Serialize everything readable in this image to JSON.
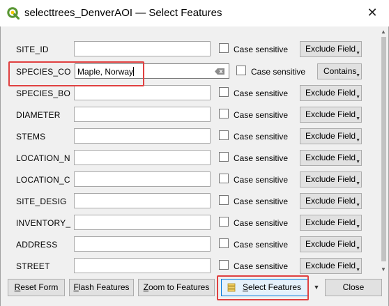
{
  "window": {
    "title": "selecttrees_DenverAOI — Select Features",
    "close_glyph": "✕"
  },
  "fields": [
    {
      "label": "SITE_ID",
      "value": "",
      "case_label": "Case sensitive",
      "mode": "Exclude Field"
    },
    {
      "label": "SPECIES_CO",
      "value": "Maple, Norway",
      "case_label": "Case sensitive",
      "mode": "Contains"
    },
    {
      "label": "SPECIES_BO",
      "value": "",
      "case_label": "Case sensitive",
      "mode": "Exclude Field"
    },
    {
      "label": "DIAMETER",
      "value": "",
      "case_label": "Case sensitive",
      "mode": "Exclude Field"
    },
    {
      "label": "STEMS",
      "value": "",
      "case_label": "Case sensitive",
      "mode": "Exclude Field"
    },
    {
      "label": "LOCATION_N",
      "value": "",
      "case_label": "Case sensitive",
      "mode": "Exclude Field"
    },
    {
      "label": "LOCATION_C",
      "value": "",
      "case_label": "Case sensitive",
      "mode": "Exclude Field"
    },
    {
      "label": "SITE_DESIG",
      "value": "",
      "case_label": "Case sensitive",
      "mode": "Exclude Field"
    },
    {
      "label": "INVENTORY_",
      "value": "",
      "case_label": "Case sensitive",
      "mode": "Exclude Field"
    },
    {
      "label": "ADDRESS",
      "value": "",
      "case_label": "Case sensitive",
      "mode": "Exclude Field"
    },
    {
      "label": "STREET",
      "value": "",
      "case_label": "Case sensitive",
      "mode": "Exclude Field"
    }
  ],
  "buttons": {
    "reset_ul": "R",
    "reset_rest": "eset Form",
    "flash_ul": "F",
    "flash_rest": "lash Features",
    "zoom_ul": "Z",
    "zoom_rest": "oom to Features",
    "select_ul": "S",
    "select_rest": "elect Features",
    "close": "Close"
  },
  "icons": {
    "app": "qgis-logo-icon",
    "clear": "clear-input-icon",
    "select": "select-features-icon"
  },
  "colors": {
    "highlight": "#e04040",
    "qgis_green": "#589632",
    "qgis_yellow": "#eec900"
  }
}
